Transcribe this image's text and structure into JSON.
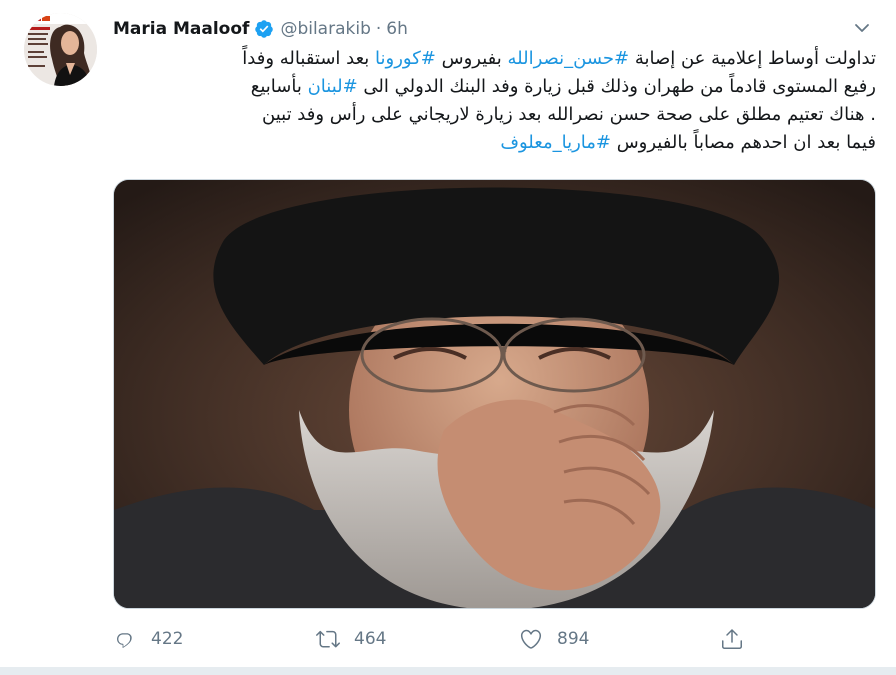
{
  "user": {
    "display_name": "Maria Maaloof",
    "handle": "@bilarakib",
    "separator": "·",
    "time": "6h"
  },
  "tweet": {
    "line1": {
      "pre": "تداولت أوساط إعلامية عن إصابة ",
      "tag1": "#حسن_نصرالله",
      "mid": " بفيروس ",
      "tag2": "#كورونا",
      "post": " بعد استقباله وفداً"
    },
    "line2": {
      "pre": "رفيع المستوى قادماً من طهران وذلك قبل زيارة وفد البنك الدولي الى ",
      "tag": "#لبنان",
      "post": " بأسابيع"
    },
    "line3": ". هناك تعتيم مطلق على صحة حسن نصرالله  بعد زيارة لاريجاني على رأس وفد تبين",
    "line4": {
      "pre": "فيما بعد ان احدهم مصاباً بالفيروس  ",
      "tag": "#ماريا_معلوف"
    }
  },
  "actions": {
    "reply_count": "422",
    "retweet_count": "464",
    "like_count": "894"
  },
  "icons": {
    "verified": "verified-badge-icon",
    "caret": "chevron-down-icon",
    "reply": "reply-icon",
    "retweet": "retweet-icon",
    "like": "heart-icon",
    "share": "share-icon"
  },
  "colors": {
    "link": "#1b95e0",
    "muted": "#657786",
    "verified": "#1da1f2",
    "text": "#14171a"
  }
}
